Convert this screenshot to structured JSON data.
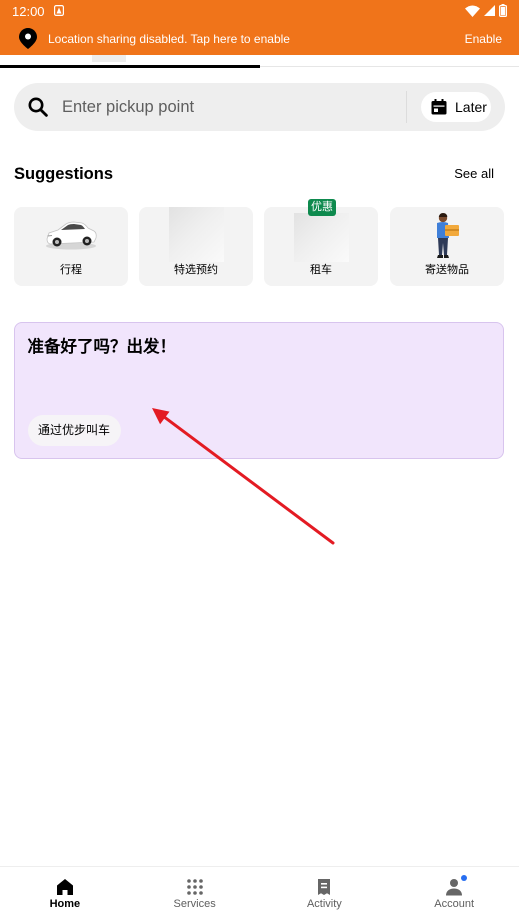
{
  "status_bar": {
    "time": "12:00",
    "icons": [
      "app-notification-icon",
      "wifi-icon",
      "signal-icon",
      "battery-icon"
    ]
  },
  "banner": {
    "icon": "location-pin-icon",
    "message": "Location sharing disabled. Tap here to enable",
    "action_label": "Enable"
  },
  "loader": {
    "progress": 0.5
  },
  "search": {
    "icon": "search-icon",
    "placeholder": "Enter pickup point",
    "later": {
      "icon": "calendar-icon",
      "label": "Later"
    }
  },
  "suggestions": {
    "title": "Suggestions",
    "see_all_label": "See all",
    "items": [
      {
        "label": "行程",
        "icon": "car-icon"
      },
      {
        "label": "特选预约",
        "icon": "image-placeholder-icon"
      },
      {
        "label": "租车",
        "icon": "image-placeholder-icon",
        "badge": "优惠"
      },
      {
        "label": "寄送物品",
        "icon": "courier-icon"
      }
    ]
  },
  "promo": {
    "title": "准备好了吗？出发！",
    "button_label": "通过优步叫车"
  },
  "bottom_nav": {
    "items": [
      {
        "label": "Home",
        "icon": "home-icon",
        "active": true
      },
      {
        "label": "Services",
        "icon": "services-grid-icon",
        "active": false
      },
      {
        "label": "Activity",
        "icon": "activity-receipt-icon",
        "active": false
      },
      {
        "label": "Account",
        "icon": "account-icon",
        "active": false,
        "has_notification_dot": true
      }
    ]
  },
  "colors": {
    "banner": "#F0741A",
    "promo_background": "#F1E5FC",
    "promo_border": "#D8C4EE",
    "badge": "#0E8A4E",
    "notification_dot": "#276EF1",
    "annotation_arrow": "#E31B23"
  }
}
